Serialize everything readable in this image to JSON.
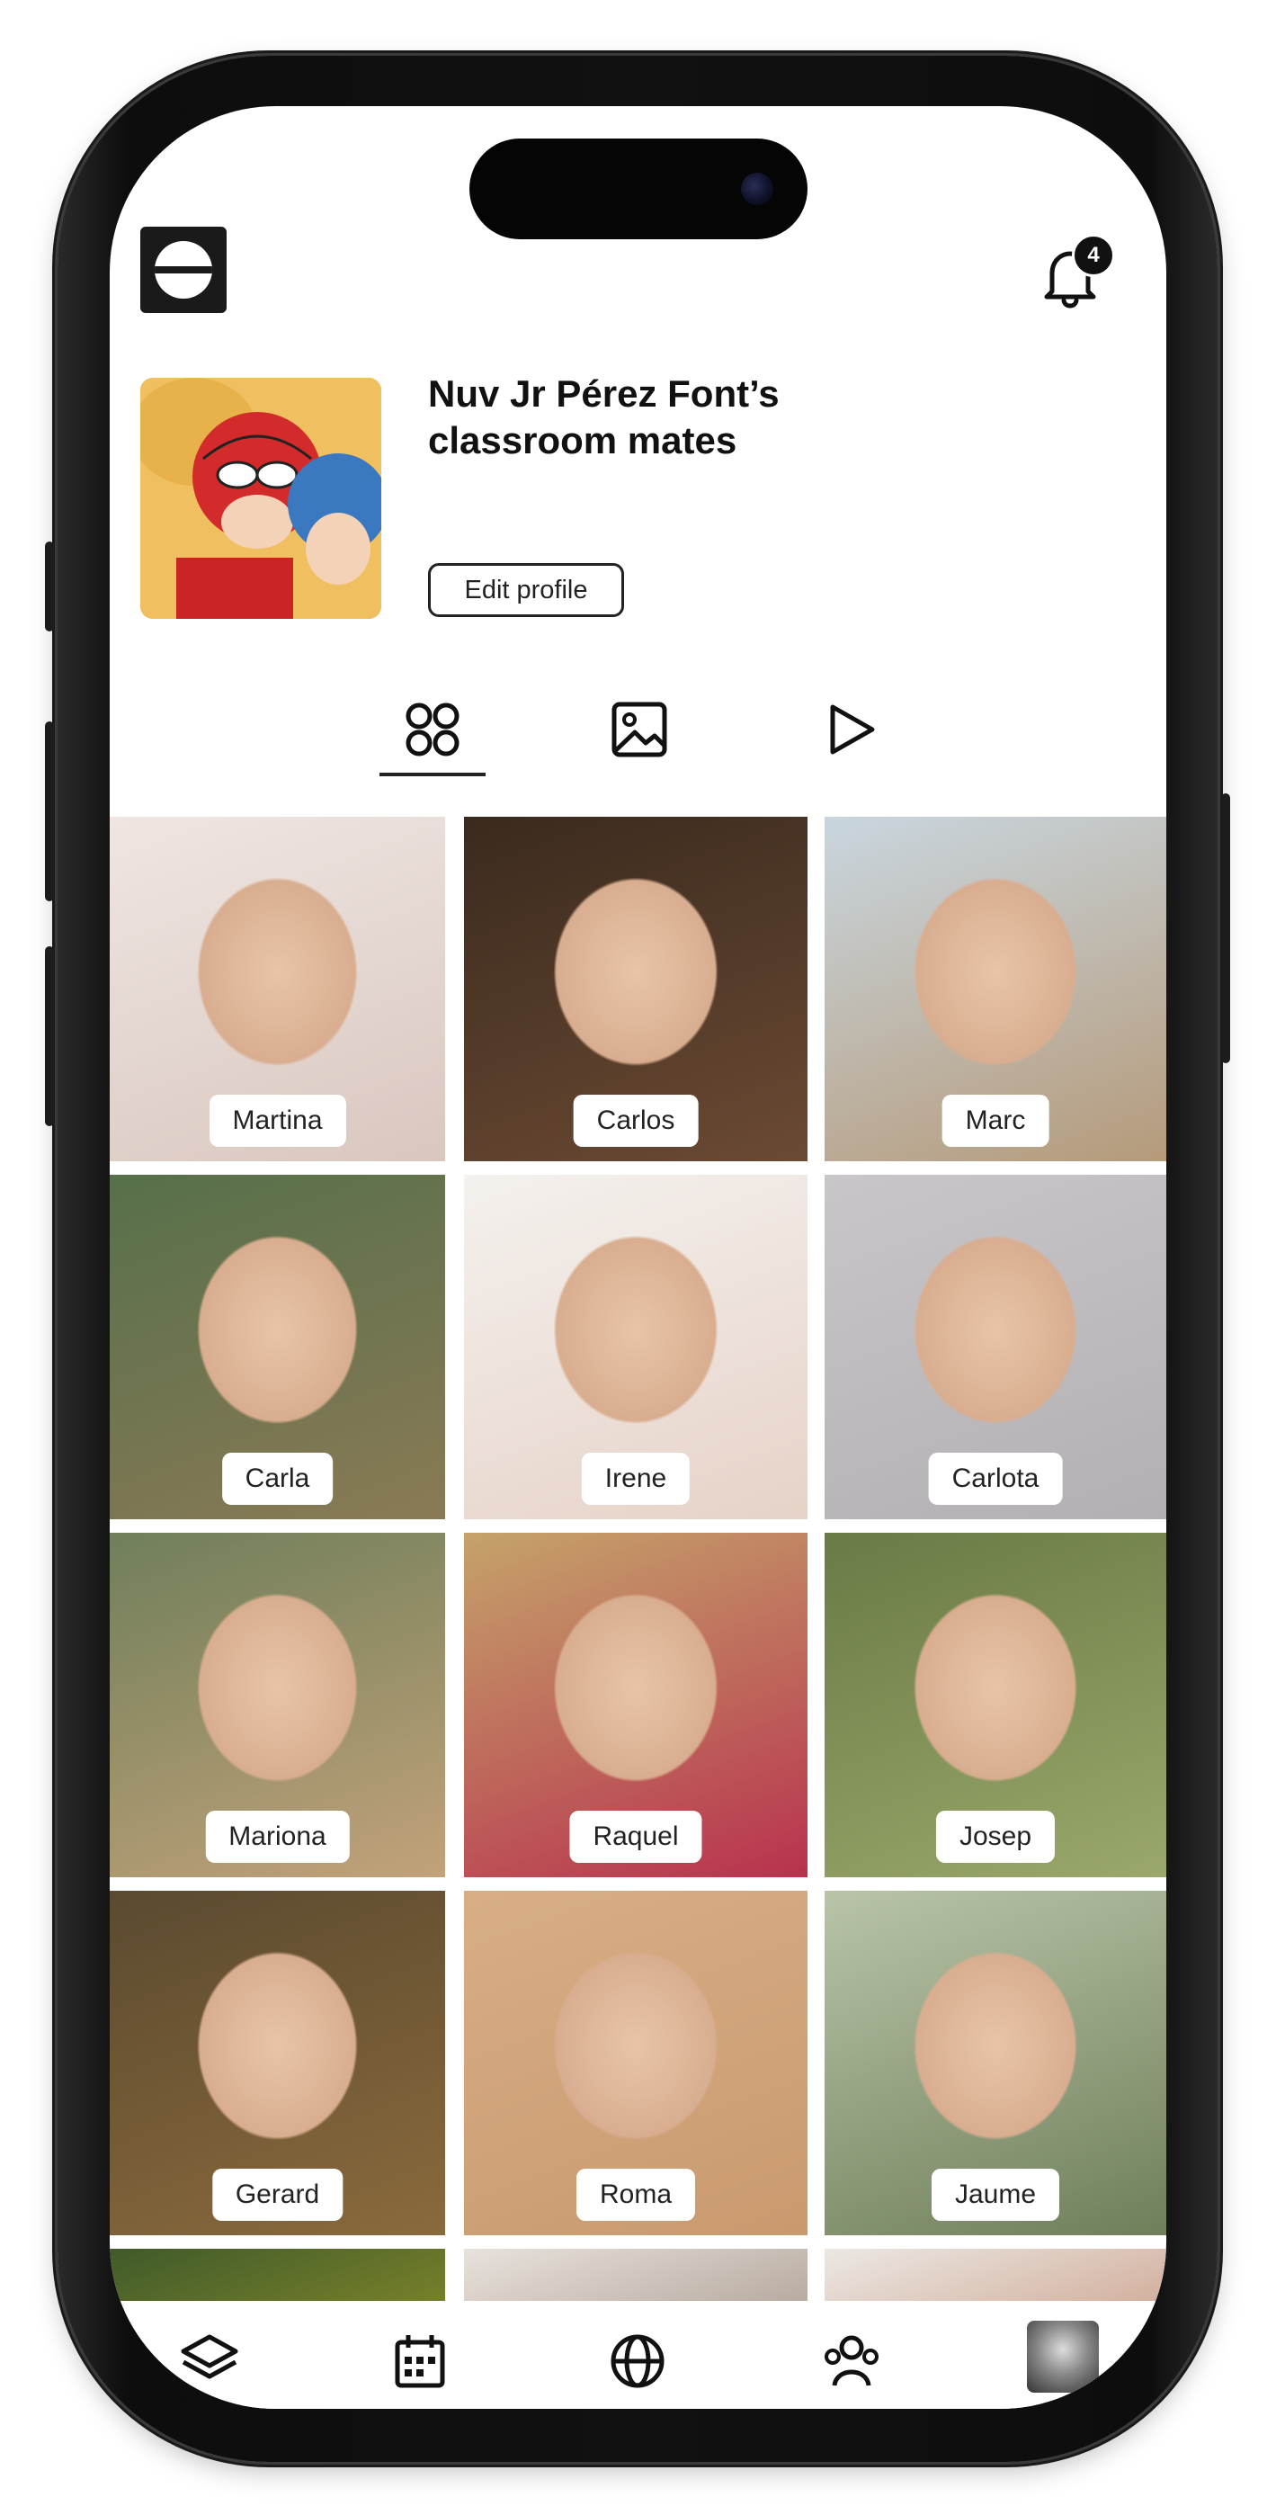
{
  "header": {
    "notification_count": "4"
  },
  "profile": {
    "title": "Nuv Jr Pérez Font’s classroom mates",
    "edit_label": "Edit profile"
  },
  "tabs": [
    {
      "name": "grid-tab",
      "icon": "grid-icon",
      "active": true
    },
    {
      "name": "photos-tab",
      "icon": "image-icon",
      "active": false
    },
    {
      "name": "videos-tab",
      "icon": "play-icon",
      "active": false
    }
  ],
  "classmates": [
    {
      "name": "Martina",
      "colors": [
        "#efe6e2",
        "#d9c7bf"
      ]
    },
    {
      "name": "Carlos",
      "colors": [
        "#3a2a1e",
        "#6b4a33"
      ]
    },
    {
      "name": "Marc",
      "colors": [
        "#c9d6df",
        "#b59a7a"
      ]
    },
    {
      "name": "Carla",
      "colors": [
        "#56704a",
        "#8a7a56"
      ]
    },
    {
      "name": "Irene",
      "colors": [
        "#f4f1ee",
        "#e6d2c7"
      ]
    },
    {
      "name": "Carlota",
      "colors": [
        "#c8c6c8",
        "#b3b0b3"
      ]
    },
    {
      "name": "Mariona",
      "colors": [
        "#6f7f5a",
        "#c2a27a"
      ]
    },
    {
      "name": "Raquel",
      "colors": [
        "#c5a36a",
        "#b8324e"
      ]
    },
    {
      "name": "Josep",
      "colors": [
        "#6a7a45",
        "#9aa86b"
      ]
    },
    {
      "name": "Gerard",
      "colors": [
        "#5b4a30",
        "#8a6a3c"
      ]
    },
    {
      "name": "Roma",
      "colors": [
        "#d8ae86",
        "#c99a6e"
      ]
    },
    {
      "name": "Jaume",
      "colors": [
        "#b9c4a8",
        "#6f7f5a"
      ]
    },
    {
      "name": "",
      "colors": [
        "#3f5a2a",
        "#d6c02a"
      ]
    },
    {
      "name": "",
      "colors": [
        "#e8e2dc",
        "#6a5240"
      ]
    },
    {
      "name": "",
      "colors": [
        "#ece8e4",
        "#a8542a"
      ]
    }
  ],
  "bottom_nav": [
    {
      "name": "layers-icon"
    },
    {
      "name": "calendar-icon"
    },
    {
      "name": "globe-icon"
    },
    {
      "name": "people-icon"
    },
    {
      "name": "profile-avatar"
    }
  ]
}
